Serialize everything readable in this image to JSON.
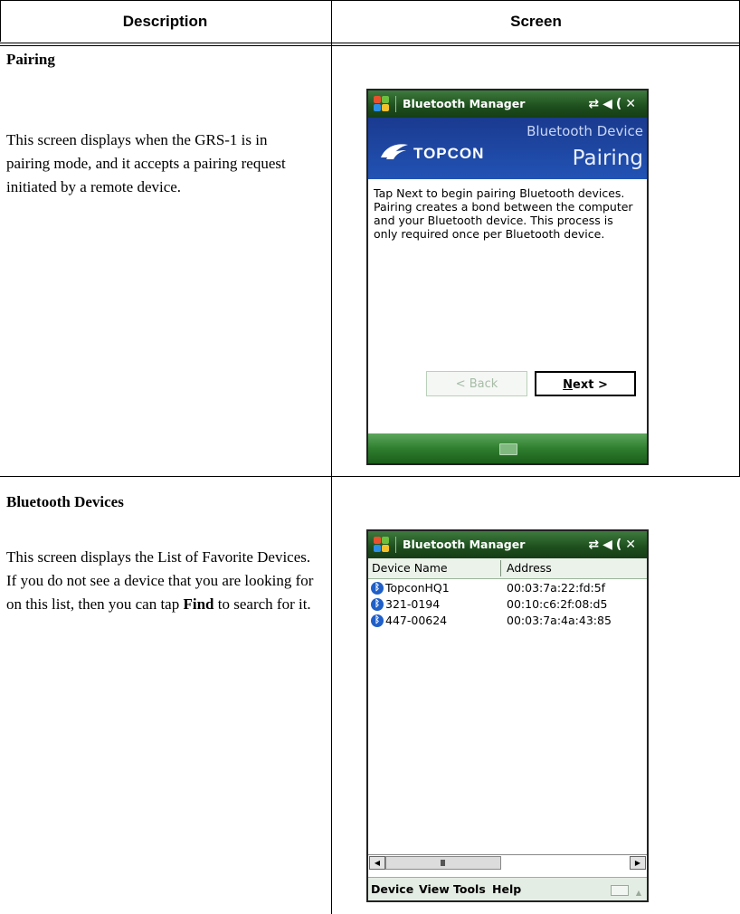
{
  "header": {
    "description": "Description",
    "screen": "Screen"
  },
  "rows": [
    {
      "title": "Pairing",
      "text": "This screen displays when the GRS-1 is in pairing mode, and it accepts a pairing request initiated by a remote device.",
      "device": {
        "app_title": "Bluetooth Manager",
        "logo_text": "TOPCON",
        "banner_line1": "Bluetooth Device",
        "banner_line2": "Pairing",
        "body": "Tap Next to begin pairing Bluetooth devices. Pairing creates a bond between the computer and your Bluetooth device. This process is only required once per Bluetooth device.",
        "back_label": "< Back",
        "next_accel": "N",
        "next_rest": "ext >"
      }
    },
    {
      "title": "Bluetooth Devices",
      "text_before": "This screen displays the List of Favorite Devices. If you do not see a device that you are looking for on this list, then you can tap ",
      "text_bold": "Find",
      "text_after": " to search for it.",
      "device": {
        "app_title": "Bluetooth Manager",
        "columns": [
          "Device Name",
          "Address"
        ],
        "devices": [
          {
            "name": "TopconHQ1",
            "address": "00:03:7a:22:fd:5f"
          },
          {
            "name": "321-0194",
            "address": "00:10:c6:2f:08:d5"
          },
          {
            "name": "447-00624",
            "address": "00:03:7a:4a:43:85"
          }
        ],
        "menu": [
          "Device",
          "View",
          "Tools",
          "Help"
        ]
      }
    }
  ],
  "colors": {
    "title_bar": "#1d4e1d",
    "banner": "#2253b5",
    "softkey_bar": "#2f7e2f",
    "bt_icon": "#1f5fc8"
  }
}
